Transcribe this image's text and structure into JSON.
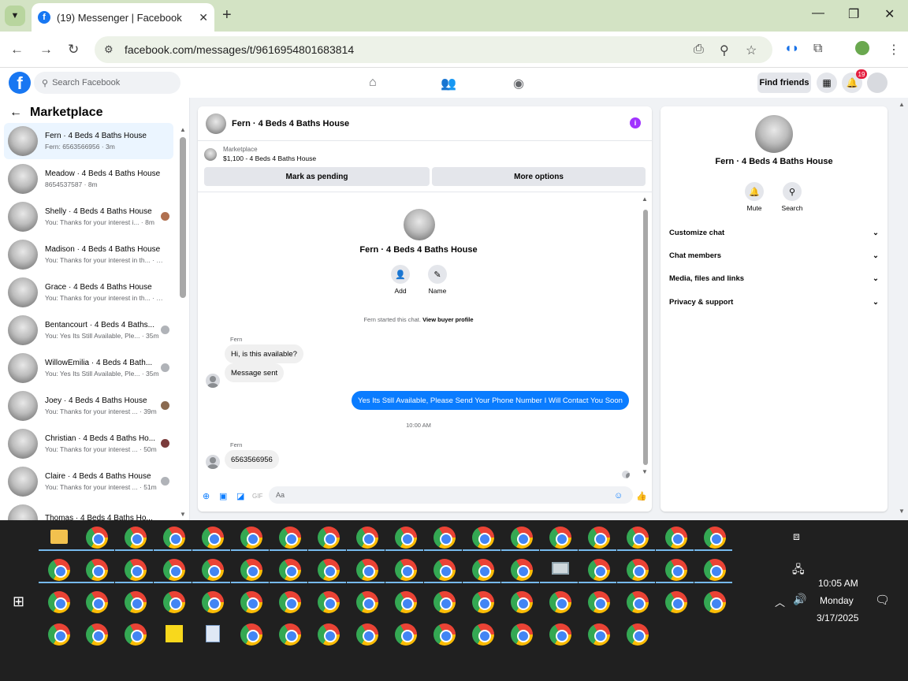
{
  "browser": {
    "tab_title": "(19) Messenger | Facebook",
    "url": "facebook.com/messages/t/9616954801683814"
  },
  "fb": {
    "search_placeholder": "Search Facebook",
    "find_friends": "Find friends",
    "notif_count": "19"
  },
  "sidebar": {
    "title": "Marketplace",
    "conversations": [
      {
        "name": "Fern · 4 Beds 4 Baths House",
        "snippet": "Fern: 6563566956 · 3m"
      },
      {
        "name": "Meadow · 4 Beds 4 Baths House",
        "snippet": "8654537587 · 8m"
      },
      {
        "name": "Shelly · 4 Beds 4 Baths House",
        "snippet": "You: Thanks for your interest i... · 8m"
      },
      {
        "name": "Madison · 4 Beds 4 Baths House",
        "snippet": "You: Thanks for your interest in th... · 8m"
      },
      {
        "name": "Grace · 4 Beds 4 Baths House",
        "snippet": "You: Thanks for your interest in th... · 8m"
      },
      {
        "name": "Bentancourt · 4 Beds 4 Baths...",
        "snippet": "You: Yes Its Still Available, Ple... · 35m"
      },
      {
        "name": "WillowEmilia · 4 Beds 4 Bath...",
        "snippet": "You: Yes Its Still Available, Ple... · 35m"
      },
      {
        "name": "Joey · 4 Beds 4 Baths House",
        "snippet": "You: Thanks for your interest ... · 39m"
      },
      {
        "name": "Christian · 4 Beds 4 Baths Ho...",
        "snippet": "You: Thanks for your interest ... · 50m"
      },
      {
        "name": "Claire · 4 Beds 4 Baths House",
        "snippet": "You: Thanks for your interest ... · 51m"
      },
      {
        "name": "Thomas · 4 Beds 4 Baths Ho...",
        "snippet": ""
      }
    ]
  },
  "chat": {
    "header_name": "Fern · 4 Beds 4 Baths House",
    "marketplace_label": "Marketplace",
    "listing": "$1,100 - 4 Beds 4 Baths House",
    "mark_pending": "Mark as pending",
    "more_options": "More options",
    "profile_name": "Fern · 4 Beds 4 Baths House",
    "add_label": "Add",
    "name_label": "Name",
    "started": "Fern started this chat.",
    "view_profile": "View buyer profile",
    "sender": "Fern",
    "msg1": "Hi, is this available?",
    "msg2": "Message sent",
    "my_msg": "Yes Its Still Available, Please Send Your Phone Number I Will Contact You Soon",
    "timestamp": "10:00 AM",
    "msg3": "6563566956",
    "composer_placeholder": "Aa"
  },
  "details": {
    "name": "Fern · 4 Beds 4 Baths House",
    "mute": "Mute",
    "search": "Search",
    "sections": [
      "Customize chat",
      "Chat members",
      "Media, files and links",
      "Privacy & support"
    ]
  },
  "taskbar": {
    "time": "10:05 AM",
    "day": "Monday",
    "date": "3/17/2025"
  }
}
